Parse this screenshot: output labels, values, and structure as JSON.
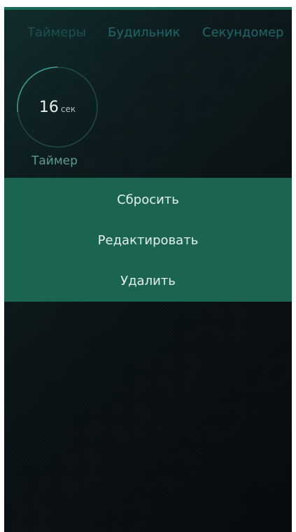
{
  "tabs": [
    {
      "label": "Таймеры"
    },
    {
      "label": "Будильник"
    },
    {
      "label": "Секундомер"
    }
  ],
  "timer": {
    "value": "16",
    "unit": "сек",
    "label": "Таймер",
    "progress": 0.27
  },
  "context_menu": {
    "reset": "Сбросить",
    "edit": "Редактировать",
    "delete": "Удалить"
  },
  "colors": {
    "accent": "#1a6451",
    "ring": "#2e8f86",
    "tab_text": "#20666a"
  }
}
